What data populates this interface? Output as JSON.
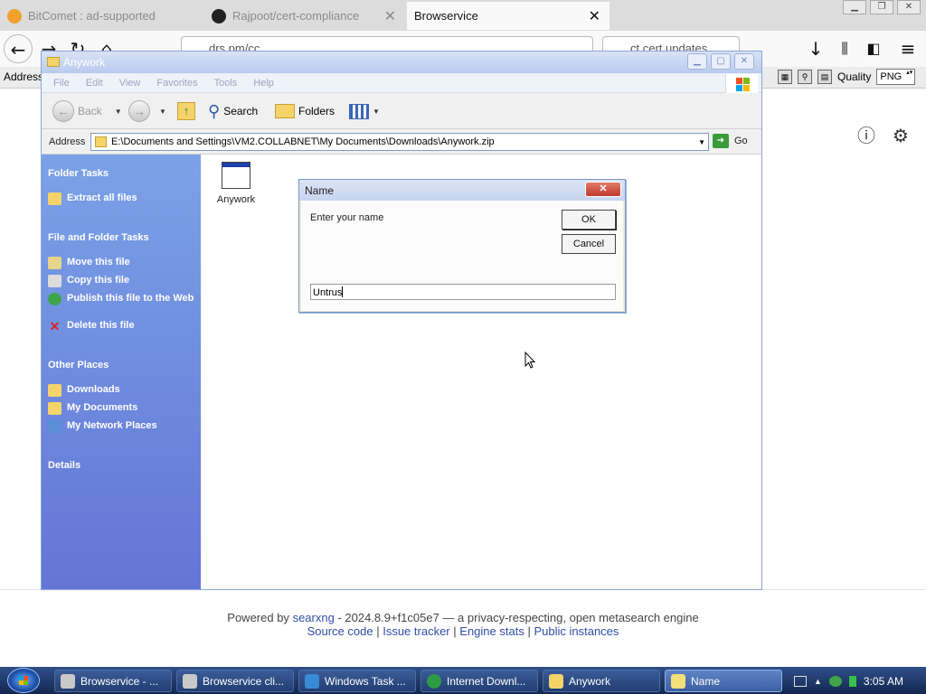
{
  "browser": {
    "tabs": [
      {
        "label": "BitComet : ad-supported",
        "active": false
      },
      {
        "label": "Rajpoot/cert-compliance",
        "active": false
      },
      {
        "label": "Browservice",
        "active": true
      }
    ],
    "address_fragment": "drs.pm/cc",
    "search_fragment": "ct cert updates",
    "bookmarks_address_label": "Address",
    "quality_label": "Quality",
    "quality_value": "PNG"
  },
  "page": {
    "footer_powered": "Powered by",
    "footer_engine": "searxng",
    "footer_version": "- 2024.8.9+f1c05e7 — a privacy-respecting, open metasearch engine",
    "footer_links": [
      "Source code",
      "Issue tracker",
      "Engine stats",
      "Public instances"
    ],
    "footer_sep": "|"
  },
  "explorer": {
    "title": "Anywork",
    "menu": [
      "File",
      "Edit",
      "View",
      "Favorites",
      "Tools",
      "Help"
    ],
    "toolbar": {
      "back": "Back",
      "search": "Search",
      "folders": "Folders"
    },
    "address_label": "Address",
    "address_value": "E:\\Documents and Settings\\VM2.COLLABNET\\My Documents\\Downloads\\Anywork.zip",
    "go_label": "Go",
    "panel": {
      "folder_tasks_title": "Folder Tasks",
      "folder_tasks": [
        "Extract all files"
      ],
      "file_tasks_title": "File and Folder Tasks",
      "file_tasks": [
        "Move this file",
        "Copy this file",
        "Publish this file to the Web",
        "Delete this file"
      ],
      "other_places_title": "Other Places",
      "other_places": [
        "Downloads",
        "My Documents",
        "My Network Places"
      ],
      "details_title": "Details"
    },
    "file_name": "Anywork"
  },
  "dialog": {
    "title": "Name",
    "prompt": "Enter your name",
    "ok_label": "OK",
    "cancel_label": "Cancel",
    "input_value": "Untrus"
  },
  "taskbar": {
    "tasks": [
      {
        "label": "Browservice - ...",
        "active": false
      },
      {
        "label": "Browservice cli...",
        "active": false
      },
      {
        "label": "Windows Task ...",
        "active": false
      },
      {
        "label": "Internet Downl...",
        "active": false
      },
      {
        "label": "Anywork",
        "active": false
      },
      {
        "label": "Name",
        "active": true
      }
    ],
    "clock": "3:05 AM"
  }
}
